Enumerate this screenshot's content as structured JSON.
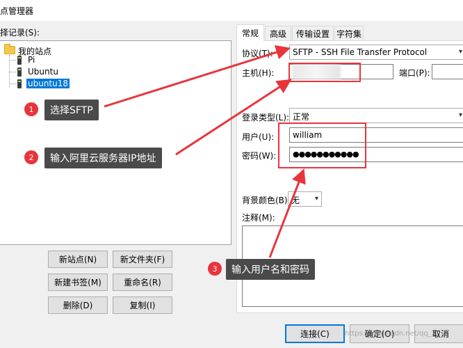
{
  "window": {
    "title": "点管理器"
  },
  "site_list_label": "择记录(S):",
  "tree": {
    "root": "我的站点",
    "items": [
      "Pi",
      "Ubuntu",
      "ubuntu18"
    ]
  },
  "buttons": {
    "new_site": "新站点(N)",
    "new_folder": "新文件夹(F)",
    "new_bookmark": "新建书签(M)",
    "rename": "重命名(R)",
    "delete": "删除(D)",
    "copy": "复制(I)",
    "connect": "连接(C)",
    "ok": "确定(O)",
    "cancel": "取消"
  },
  "tabs": [
    "常规",
    "高级",
    "传输设置",
    "字符集"
  ],
  "form": {
    "protocol_label": "协议(T):",
    "protocol_value": "SFTP - SSH File Transfer Protocol",
    "host_label": "主机(H):",
    "port_label": "端口(P):",
    "logon_label": "登录类型(L):",
    "logon_value": "正常",
    "user_label": "用户(U):",
    "user_value": "william",
    "password_label": "密码(W):",
    "password_value": "●●●●●●●●●●●",
    "bg_label": "背景颜色(B)",
    "bg_value": "无",
    "comment_label": "注释(M):"
  },
  "annotations": [
    {
      "num": "1",
      "text": "选择SFTP"
    },
    {
      "num": "2",
      "text": "输入阿里云服务器IP地址"
    },
    {
      "num": "3",
      "text": "输入用户名和密码"
    }
  ],
  "watermark": "https://blog.csdn.net/qq_2...",
  "colors": {
    "annotation_red": "#e8343b",
    "callout_bg": "#4a4a4a",
    "selection": "#0078d7"
  }
}
